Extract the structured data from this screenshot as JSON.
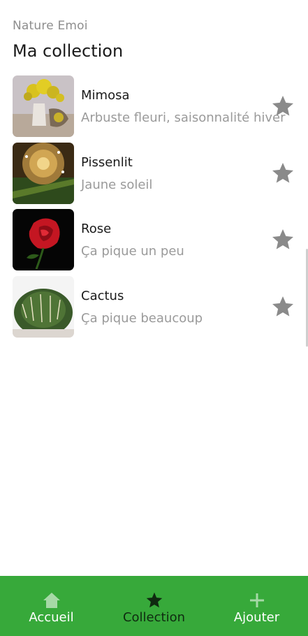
{
  "header": {
    "app_name": "Nature Emoi",
    "title": "Ma collection"
  },
  "collection": [
    {
      "name": "Mimosa",
      "description": "Arbuste fleuri, saisonnalité hiver",
      "favorite": true,
      "image": "mimosa-photo"
    },
    {
      "name": "Pissenlit",
      "description": "Jaune soleil",
      "favorite": true,
      "image": "dandelion-photo"
    },
    {
      "name": "Rose",
      "description": "Ça pique un peu",
      "favorite": true,
      "image": "rose-photo"
    },
    {
      "name": "Cactus",
      "description": "Ça pique beaucoup",
      "favorite": true,
      "image": "cactus-photo"
    }
  ],
  "bottom_nav": {
    "items": [
      {
        "label": "Accueil",
        "icon": "home-icon",
        "active": false
      },
      {
        "label": "Collection",
        "icon": "star-icon",
        "active": true
      },
      {
        "label": "Ajouter",
        "icon": "plus-icon",
        "active": false
      }
    ]
  },
  "colors": {
    "nav_background": "#37a93a",
    "nav_active": "#0f2a10",
    "nav_inactive": "#ffffff",
    "star": "#8a8a8a"
  }
}
